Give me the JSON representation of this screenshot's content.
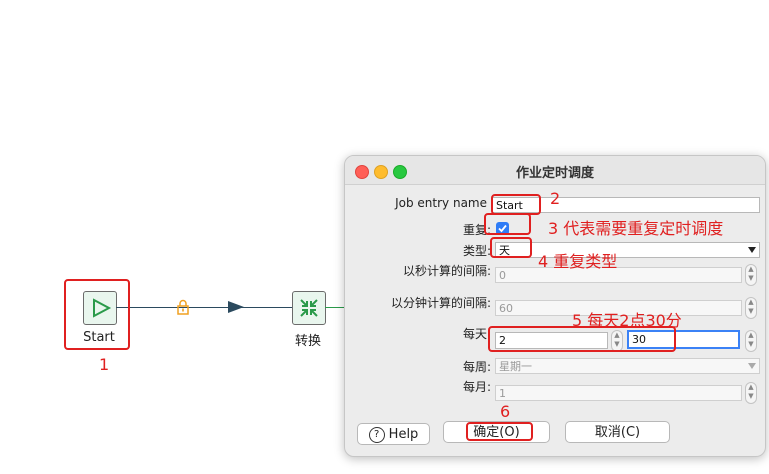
{
  "canvas": {
    "start_label": "Start",
    "transform_label": "转换"
  },
  "dialog": {
    "title": "作业定时调度",
    "job_entry_name_label": "Job entry name",
    "job_entry_name_value": "Start",
    "repeat_label": "重复:",
    "type_label": "类型:",
    "type_value": "天",
    "interval_seconds_label": "以秒计算的间隔:",
    "interval_seconds_value": "0",
    "interval_minutes_label": "以分钟计算的间隔:",
    "interval_minutes_value": "60",
    "daily_label": "每天:",
    "daily_hour_value": "2",
    "daily_minute_value": "30",
    "weekly_label": "每周:",
    "weekly_value": "星期一",
    "monthly_label": "每月:",
    "monthly_value": "1",
    "help_label": "Help",
    "ok_label": "确定(O)",
    "cancel_label": "取消(C)"
  },
  "annotations": {
    "a1": "1",
    "a2": "2",
    "a3": "3 代表需要重复定时调度",
    "a4": "4 重复类型",
    "a5": "5 每天2点30分",
    "a6": "6"
  },
  "colors": {
    "annotation": "#e02020",
    "node_fill": "#e9f6ee",
    "node_icon": "#2a9a4a",
    "lock": "#f0a020",
    "focus": "#3b82f6"
  }
}
